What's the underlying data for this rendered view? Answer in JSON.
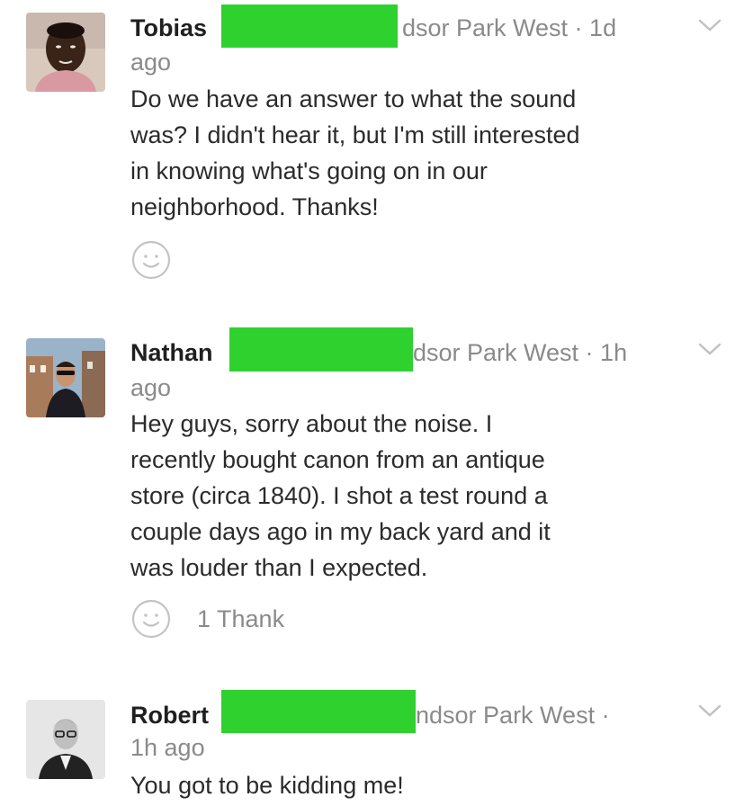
{
  "posts": [
    {
      "author": "Tobias",
      "meta_line": "dsor Park West · 1d",
      "meta_line2": "ago",
      "body": "Do we have an answer to what the sound\nwas? I didn't hear it, but I'm still interested\nin knowing what's going on in our\nneighborhood. Thanks!",
      "thanks": ""
    },
    {
      "author": "Nathan",
      "meta_line": "dsor Park West · 1h",
      "meta_line2": "ago",
      "body": "Hey guys, sorry about the noise. I\nrecently bought canon from an antique\nstore (circa 1840). I shot a test round a\ncouple days ago in my back yard and it\nwas louder than I expected.",
      "thanks": "1 Thank"
    },
    {
      "author": "Robert",
      "meta_line": "ndsor Park West ·",
      "meta_line2": "1h ago",
      "body": "You got to be kidding me!",
      "thanks": ""
    }
  ],
  "icons": {
    "reaction": "smiley-icon",
    "menu": "chevron-down-icon"
  },
  "colors": {
    "redaction": "#2fd12f",
    "meta_text": "#8a8a8a",
    "body_text": "#2b2b2b"
  }
}
